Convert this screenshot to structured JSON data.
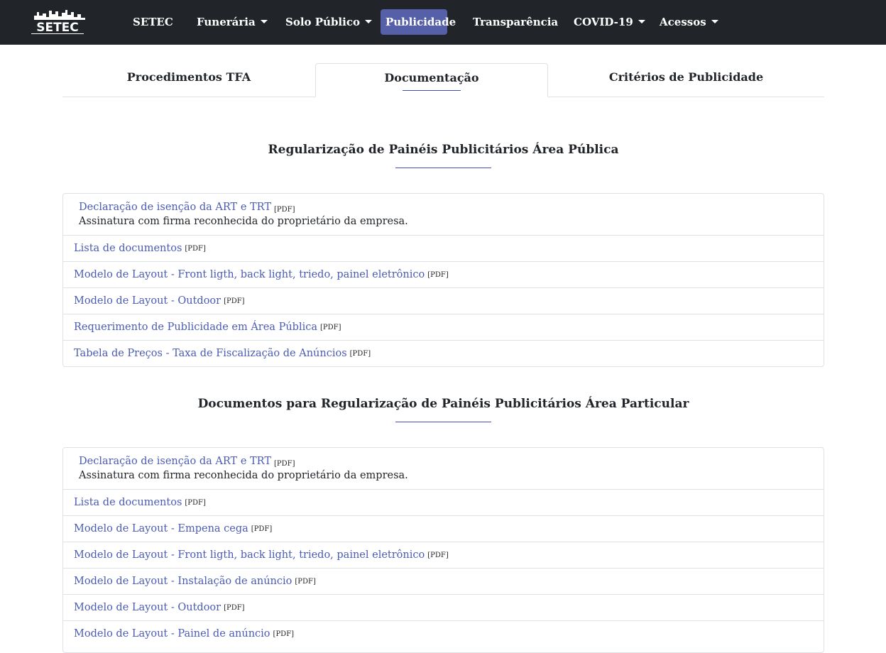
{
  "nav": {
    "brand": "SETEC",
    "items": [
      {
        "label": "SETEC",
        "dropdown": false,
        "active": false
      },
      {
        "label": "Funerária",
        "dropdown": true,
        "active": false
      },
      {
        "label": "Solo Público",
        "dropdown": true,
        "active": false
      },
      {
        "label": "Publicidade",
        "dropdown": false,
        "active": true
      },
      {
        "label": "Transparência",
        "dropdown": false,
        "active": false
      },
      {
        "label": "COVID-19",
        "dropdown": true,
        "active": false
      },
      {
        "label": "Acessos",
        "dropdown": true,
        "active": false
      }
    ]
  },
  "tabs": [
    {
      "label": "Procedimentos TFA",
      "active": false
    },
    {
      "label": "Documentação",
      "active": true
    },
    {
      "label": "Critérios de Publicidade",
      "active": false
    }
  ],
  "sections": [
    {
      "title": "Regularização de Painéis Publicitários Área Pública",
      "items": [
        {
          "label": "Declaração de isenção da ART e TRT",
          "tag": "[PDF]",
          "note": "Assinatura com firma reconhecida do proprietário da empresa."
        },
        {
          "label": "Lista de documentos",
          "tag": "[PDF]"
        },
        {
          "label": "Modelo de Layout - Front ligth, back light, triedo, painel eletrônico",
          "tag": "[PDF]"
        },
        {
          "label": "Modelo de Layout - Outdoor",
          "tag": "[PDF]"
        },
        {
          "label": "Requerimento de Publicidade em Área Pública",
          "tag": "[PDF]"
        },
        {
          "label": "Tabela de Preços - Taxa de Fiscalização de Anúncios",
          "tag": "[PDF]"
        }
      ]
    },
    {
      "title": "Documentos para Regularização de Painéis Publicitários Área Particular",
      "items": [
        {
          "label": "Declaração de isenção da ART e TRT",
          "tag": "[PDF]",
          "note": "Assinatura com firma reconhecida do proprietário da empresa."
        },
        {
          "label": "Lista de documentos",
          "tag": "[PDF]"
        },
        {
          "label": "Modelo de Layout - Empena cega",
          "tag": "[PDF]"
        },
        {
          "label": "Modelo de Layout - Front ligth, back light, triedo, painel eletrônico",
          "tag": "[PDF]"
        },
        {
          "label": "Modelo de Layout - Instalação de anúncio",
          "tag": "[PDF]"
        },
        {
          "label": "Modelo de Layout - Outdoor",
          "tag": "[PDF]"
        },
        {
          "label": "Modelo de Layout - Painel de anúncio",
          "tag": "[PDF]"
        }
      ]
    }
  ],
  "colors": {
    "navbar": "#212529",
    "active_nav": "#5560a9",
    "link": "#4a5bb5",
    "accent_rule": "#3f51b5"
  }
}
